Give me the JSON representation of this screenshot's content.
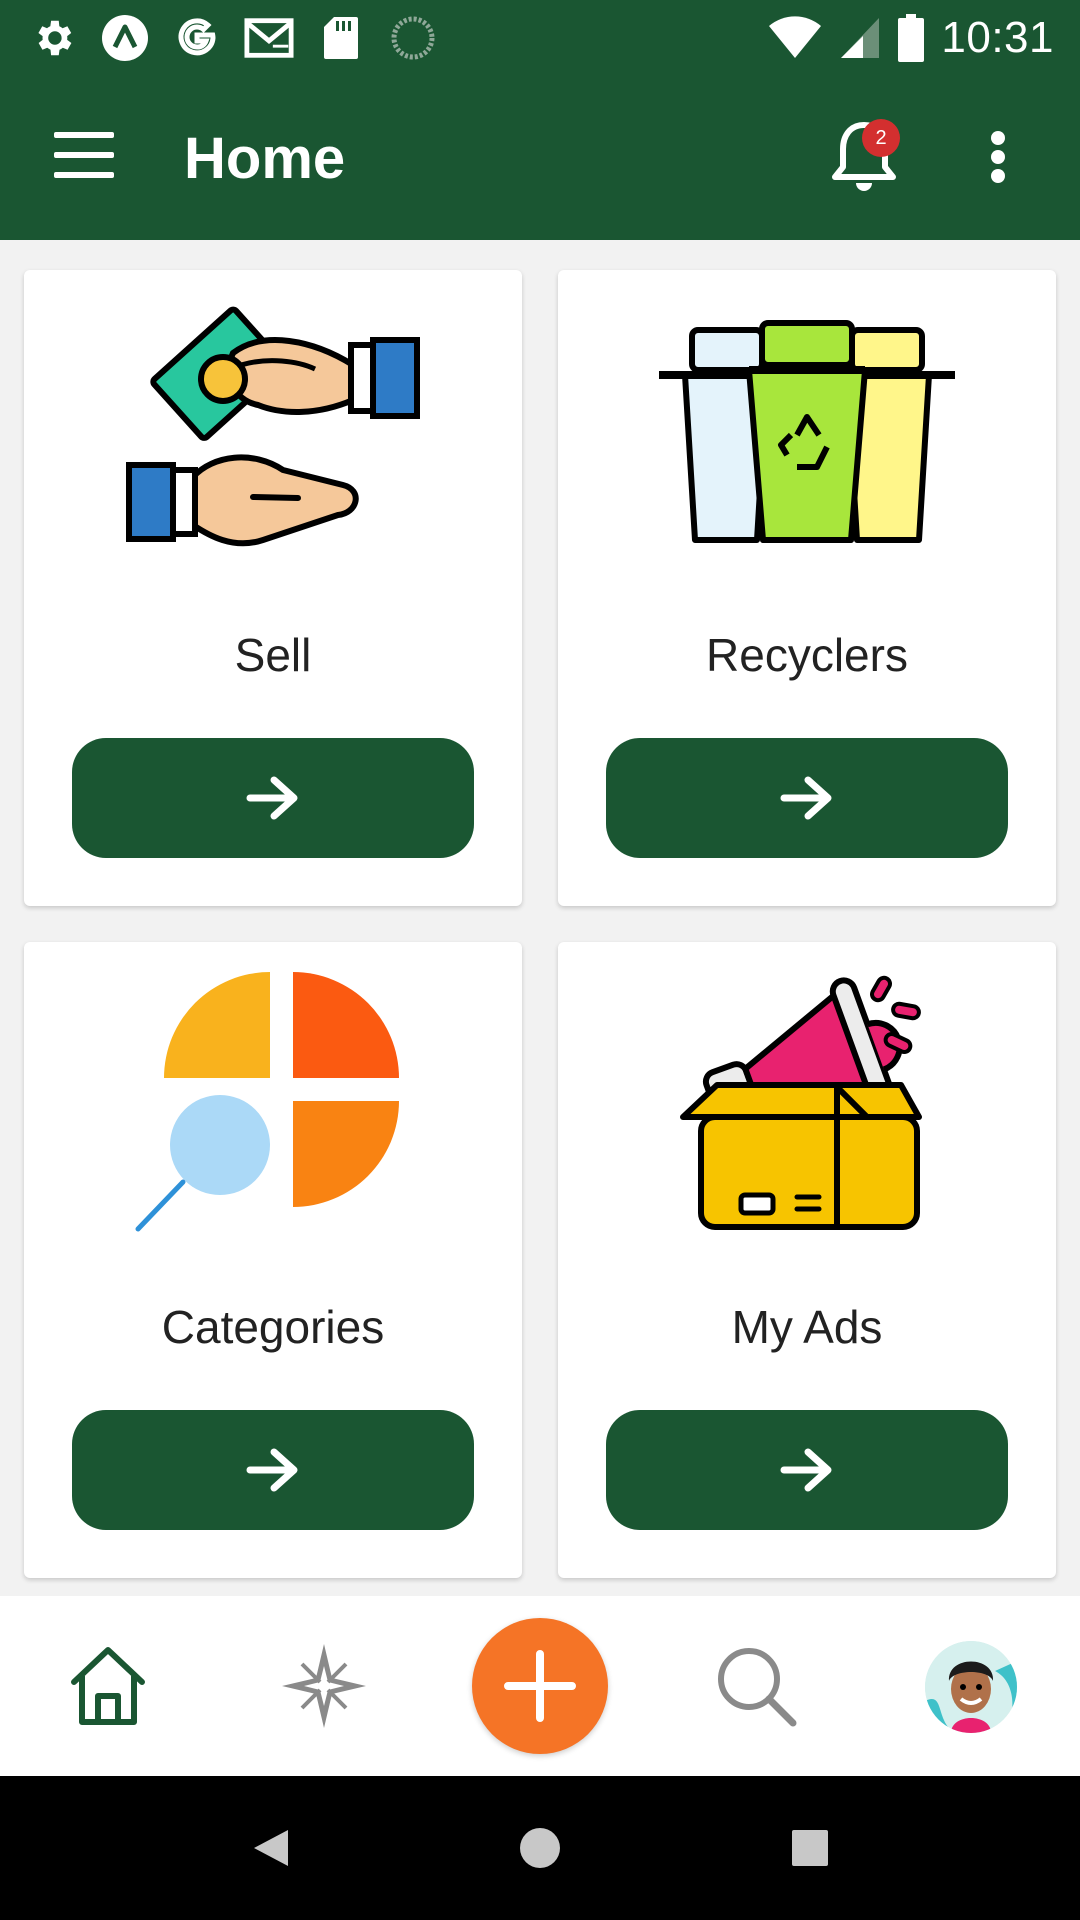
{
  "status_bar": {
    "time": "10:31",
    "left_icons": [
      "settings-icon",
      "app-logo-icon",
      "google-icon",
      "gmail-icon",
      "sd-card-icon",
      "sync-icon"
    ],
    "right_icons": [
      "wifi-icon",
      "signal-icon",
      "battery-icon"
    ]
  },
  "app_bar": {
    "title": "Home",
    "notification_count": "2",
    "icons": [
      "menu-icon",
      "bell-icon",
      "more-vert-icon"
    ]
  },
  "cards": [
    {
      "label": "Sell",
      "icon": "money-hands-icon",
      "button_icon": "arrow-right-icon"
    },
    {
      "label": "Recyclers",
      "icon": "recycle-bins-icon",
      "button_icon": "arrow-right-icon"
    },
    {
      "label": "Categories",
      "icon": "categories-chart-icon",
      "button_icon": "arrow-right-icon"
    },
    {
      "label": "My Ads",
      "icon": "megaphone-box-icon",
      "button_icon": "arrow-right-icon"
    }
  ],
  "bottom_nav": {
    "items": [
      "home-icon",
      "compass-icon",
      "add-icon",
      "search-icon",
      "profile-avatar"
    ],
    "active": "home-icon"
  },
  "system_nav": [
    "back-icon",
    "home-circle-icon",
    "recents-icon"
  ],
  "colors": {
    "primary": "#1a5632",
    "accent": "#f57426",
    "badge": "#d32f2f",
    "background": "#f2f2f2"
  }
}
